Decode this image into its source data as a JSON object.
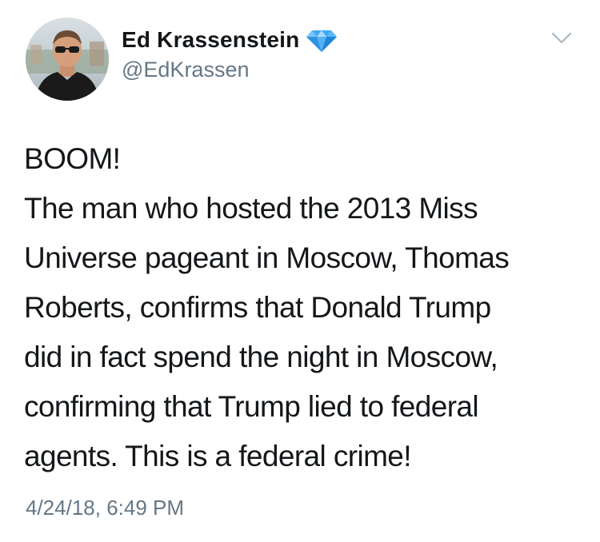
{
  "author": {
    "display_name": "Ed Krassenstein",
    "handle": "@EdKrassen",
    "badge_icon": "diamond-icon",
    "badge_color": "#3fa9f5"
  },
  "tweet": {
    "lines": [
      "BOOM!",
      "The man who hosted the 2013 Miss",
      "Universe pageant in Moscow, Thomas",
      "Roberts, confirms that Donald Trump",
      "did in fact spend the night in Moscow,",
      "confirming that Trump lied to federal",
      "agents. This is a federal crime!"
    ],
    "timestamp": "4/24/18, 6:49 PM"
  },
  "menu_icon": "chevron-down-icon",
  "colors": {
    "text": "#14171a",
    "secondary": "#657786",
    "caret": "#aab8c2"
  }
}
